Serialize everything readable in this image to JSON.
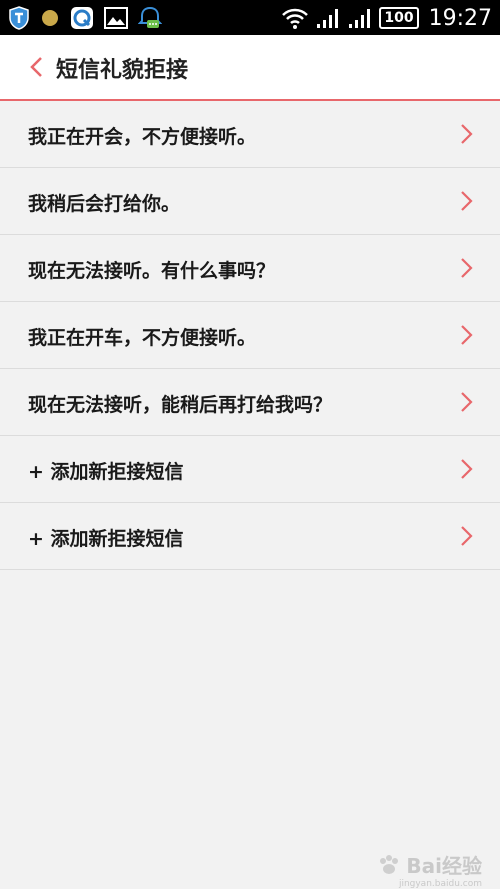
{
  "status_bar": {
    "battery": "100",
    "time": "19:27",
    "icons": [
      "shield-icon",
      "coin-icon",
      "app-q-icon",
      "gallery-icon",
      "chat-icon",
      "wifi-icon",
      "signal-icon",
      "signal-icon",
      "battery-icon"
    ]
  },
  "header": {
    "title": "短信礼貌拒接",
    "back_icon": "chevron-left-icon"
  },
  "list": {
    "items": [
      {
        "label": "我正在开会，不方便接听。"
      },
      {
        "label": "我稍后会打给你。"
      },
      {
        "label": "现在无法接听。有什么事吗？"
      },
      {
        "label": "我正在开车，不方便接听。"
      },
      {
        "label": "现在无法接听，能稍后再打给我吗？"
      },
      {
        "label": "+ 添加新拒接短信"
      },
      {
        "label": "+ 添加新拒接短信"
      }
    ]
  },
  "watermark": {
    "text": "Bai经验",
    "sub": "jingyan.baidu.com"
  },
  "colors": {
    "accent": "#e8676b",
    "background": "#f2f2f2",
    "status_bar": "#000000"
  }
}
